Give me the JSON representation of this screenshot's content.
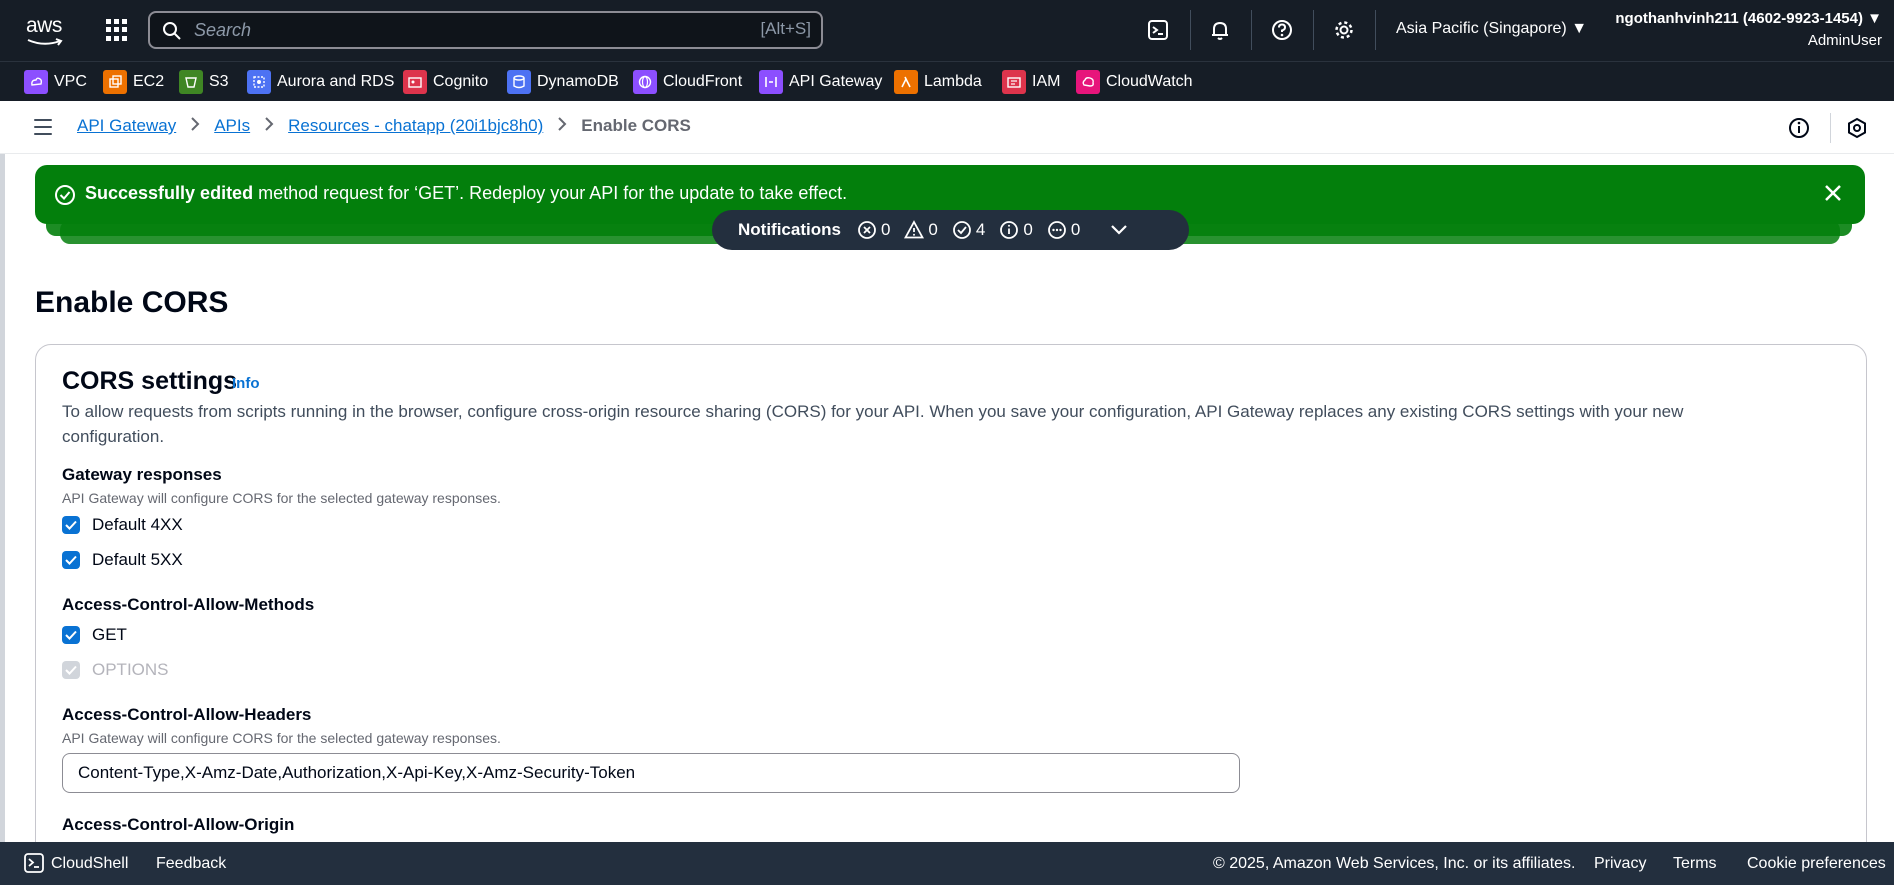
{
  "topnav": {
    "logo_text": "aws",
    "search_placeholder": "Search",
    "search_shortcut": "[Alt+S]",
    "region": "Asia Pacific (Singapore) ▼",
    "user_name": "ngothanhvinh211 (4602-9923-1454) ▼",
    "user_role": "AdminUser"
  },
  "favorites": [
    {
      "label": "VPC",
      "color": "#8c4fff"
    },
    {
      "label": "EC2",
      "color": "#ed7100"
    },
    {
      "label": "S3",
      "color": "#3f8624"
    },
    {
      "label": "Aurora and RDS",
      "color": "#4d72f3"
    },
    {
      "label": "Cognito",
      "color": "#dd344c"
    },
    {
      "label": "DynamoDB",
      "color": "#4d72f3"
    },
    {
      "label": "CloudFront",
      "color": "#8c4fff"
    },
    {
      "label": "API Gateway",
      "color": "#8c4fff"
    },
    {
      "label": "Lambda",
      "color": "#ed7100"
    },
    {
      "label": "IAM",
      "color": "#dd344c"
    },
    {
      "label": "CloudWatch",
      "color": "#e7157b"
    }
  ],
  "breadcrumbs": {
    "items": [
      "API Gateway",
      "APIs",
      "Resources - chatapp (20i1bjc8h0)"
    ],
    "current": "Enable CORS"
  },
  "flash": {
    "bold": "Successfully edited",
    "message": " method request for ‘GET’. Redeploy your API for the update to take effect."
  },
  "notifications": {
    "label": "Notifications",
    "error": "0",
    "warning": "0",
    "success": "4",
    "info": "0",
    "progress": "0"
  },
  "page": {
    "title": "Enable CORS"
  },
  "cors": {
    "title": "CORS settings",
    "info": "Info",
    "description": "To allow requests from scripts running in the browser, configure cross-origin resource sharing (CORS) for your API. When you save your configuration, API Gateway replaces any existing CORS settings with your new configuration.",
    "gateway_label": "Gateway responses",
    "gateway_desc": "API Gateway will configure CORS for the selected gateway responses.",
    "default4xx": "Default 4XX",
    "default5xx": "Default 5XX",
    "methods_label": "Access-Control-Allow-Methods",
    "method_get": "GET",
    "method_options": "OPTIONS",
    "headers_label": "Access-Control-Allow-Headers",
    "headers_desc": "API Gateway will configure CORS for the selected gateway responses.",
    "headers_value": "Content-Type,X-Amz-Date,Authorization,X-Api-Key,X-Amz-Security-Token",
    "origin_label": "Access-Control-Allow-Origin"
  },
  "footer": {
    "cloudshell": "CloudShell",
    "feedback": "Feedback",
    "copyright": "© 2025, Amazon Web Services, Inc. or its affiliates.",
    "privacy": "Privacy",
    "terms": "Terms",
    "cookies": "Cookie preferences"
  }
}
